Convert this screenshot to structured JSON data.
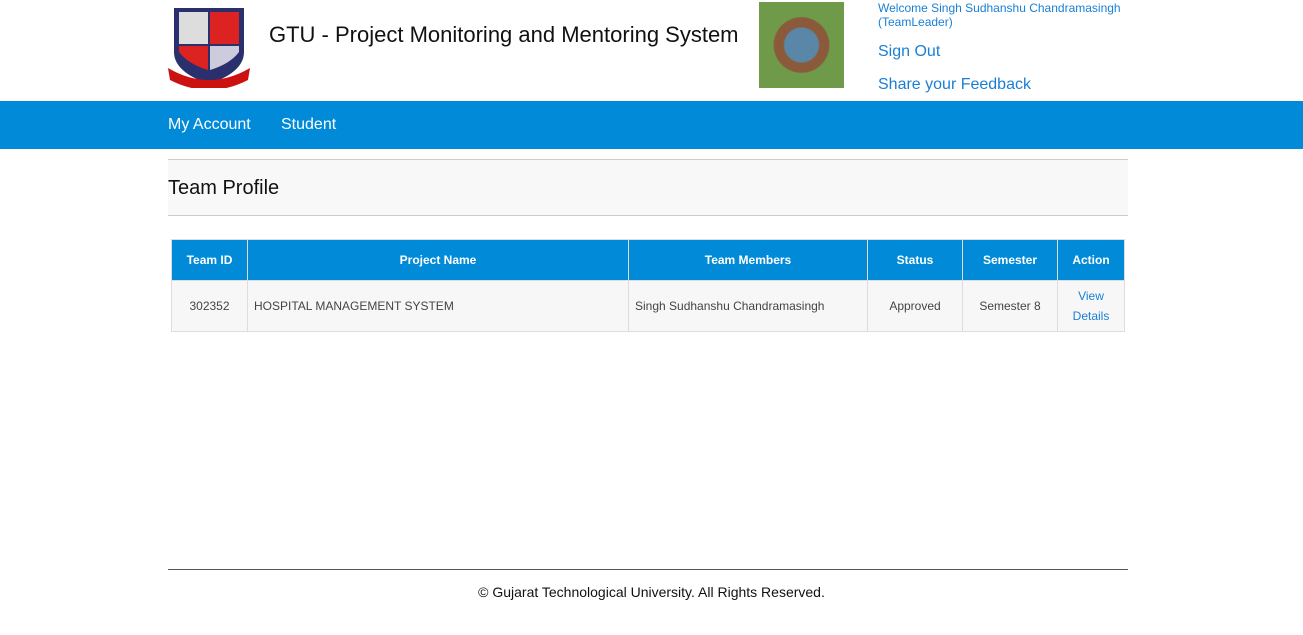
{
  "header": {
    "title": "GTU - Project Monitoring and Mentoring System",
    "welcome": "Welcome Singh Sudhanshu Chandramasingh (TeamLeader)",
    "sign_out": "Sign Out",
    "feedback": "Share your Feedback"
  },
  "nav": {
    "items": [
      {
        "label": "My Account"
      },
      {
        "label": "Student"
      }
    ]
  },
  "panel": {
    "title": "Team Profile"
  },
  "table": {
    "headers": [
      "Team ID",
      "Project Name",
      "Team Members",
      "Status",
      "Semester",
      "Action"
    ],
    "rows": [
      {
        "team_id": "302352",
        "project": "HOSPITAL MANAGEMENT SYSTEM",
        "members": "Singh Sudhanshu Chandramasingh",
        "status": "Approved",
        "semester": "Semester 8",
        "action": "View Details"
      }
    ]
  },
  "footer": {
    "text": "© Gujarat Technological University. All Rights Reserved."
  },
  "colors": {
    "accent": "#008ad8",
    "link": "#1a7fd4"
  }
}
